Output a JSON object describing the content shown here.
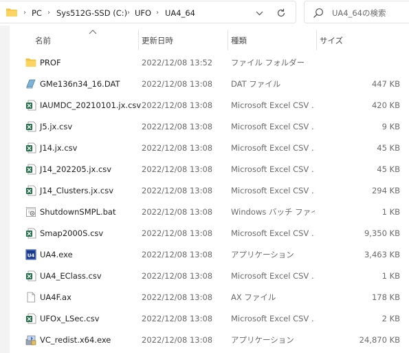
{
  "address": {
    "crumbs": [
      "PC",
      "Sys512G-SSD (C:)",
      "UFO",
      "UA4_64"
    ]
  },
  "search": {
    "placeholder": "UA4_64の検索"
  },
  "columns": {
    "name": "名前",
    "date": "更新日時",
    "type": "種類",
    "size": "サイズ"
  },
  "files": [
    {
      "name": "PROF",
      "date": "2022/12/08 13:52",
      "type": "ファイル フォルダー",
      "size": "",
      "icon": "folder-icon"
    },
    {
      "name": "GMe136n34_16.DAT",
      "date": "2022/12/08 13:08",
      "type": "DAT ファイル",
      "size": "447 KB",
      "icon": "dat-file-icon"
    },
    {
      "name": "IAUMDC_20210101.jx.csv",
      "date": "2022/12/08 13:08",
      "type": "Microsoft Excel CSV ...",
      "size": "420 KB",
      "icon": "excel-csv-icon"
    },
    {
      "name": "J5.jx.csv",
      "date": "2022/12/08 13:08",
      "type": "Microsoft Excel CSV ...",
      "size": "9 KB",
      "icon": "excel-csv-icon"
    },
    {
      "name": "J14.jx.csv",
      "date": "2022/12/08 13:08",
      "type": "Microsoft Excel CSV ...",
      "size": "45 KB",
      "icon": "excel-csv-icon"
    },
    {
      "name": "J14_202205.jx.csv",
      "date": "2022/12/08 13:08",
      "type": "Microsoft Excel CSV ...",
      "size": "45 KB",
      "icon": "excel-csv-icon"
    },
    {
      "name": "J14_Clusters.jx.csv",
      "date": "2022/12/08 13:08",
      "type": "Microsoft Excel CSV ...",
      "size": "294 KB",
      "icon": "excel-csv-icon"
    },
    {
      "name": "ShutdownSMPL.bat",
      "date": "2022/12/08 13:08",
      "type": "Windows バッチ ファイル",
      "size": "1 KB",
      "icon": "batch-file-icon"
    },
    {
      "name": "Smap2000S.csv",
      "date": "2022/12/08 13:08",
      "type": "Microsoft Excel CSV ...",
      "size": "9,350 KB",
      "icon": "excel-csv-icon"
    },
    {
      "name": "UA4.exe",
      "date": "2022/12/08 13:08",
      "type": "アプリケーション",
      "size": "3,463 KB",
      "icon": "ua4-app-icon"
    },
    {
      "name": "UA4_EClass.csv",
      "date": "2022/12/08 13:08",
      "type": "Microsoft Excel CSV ...",
      "size": "1 KB",
      "icon": "excel-csv-icon"
    },
    {
      "name": "UA4F.ax",
      "date": "2022/12/08 13:08",
      "type": "AX ファイル",
      "size": "178 KB",
      "icon": "blank-file-icon"
    },
    {
      "name": "UFOx_LSec.csv",
      "date": "2022/12/08 13:08",
      "type": "Microsoft Excel CSV ...",
      "size": "2 KB",
      "icon": "excel-csv-icon"
    },
    {
      "name": "VC_redist.x64.exe",
      "date": "2022/12/08 13:08",
      "type": "アプリケーション",
      "size": "24,870 KB",
      "icon": "installer-icon"
    }
  ]
}
